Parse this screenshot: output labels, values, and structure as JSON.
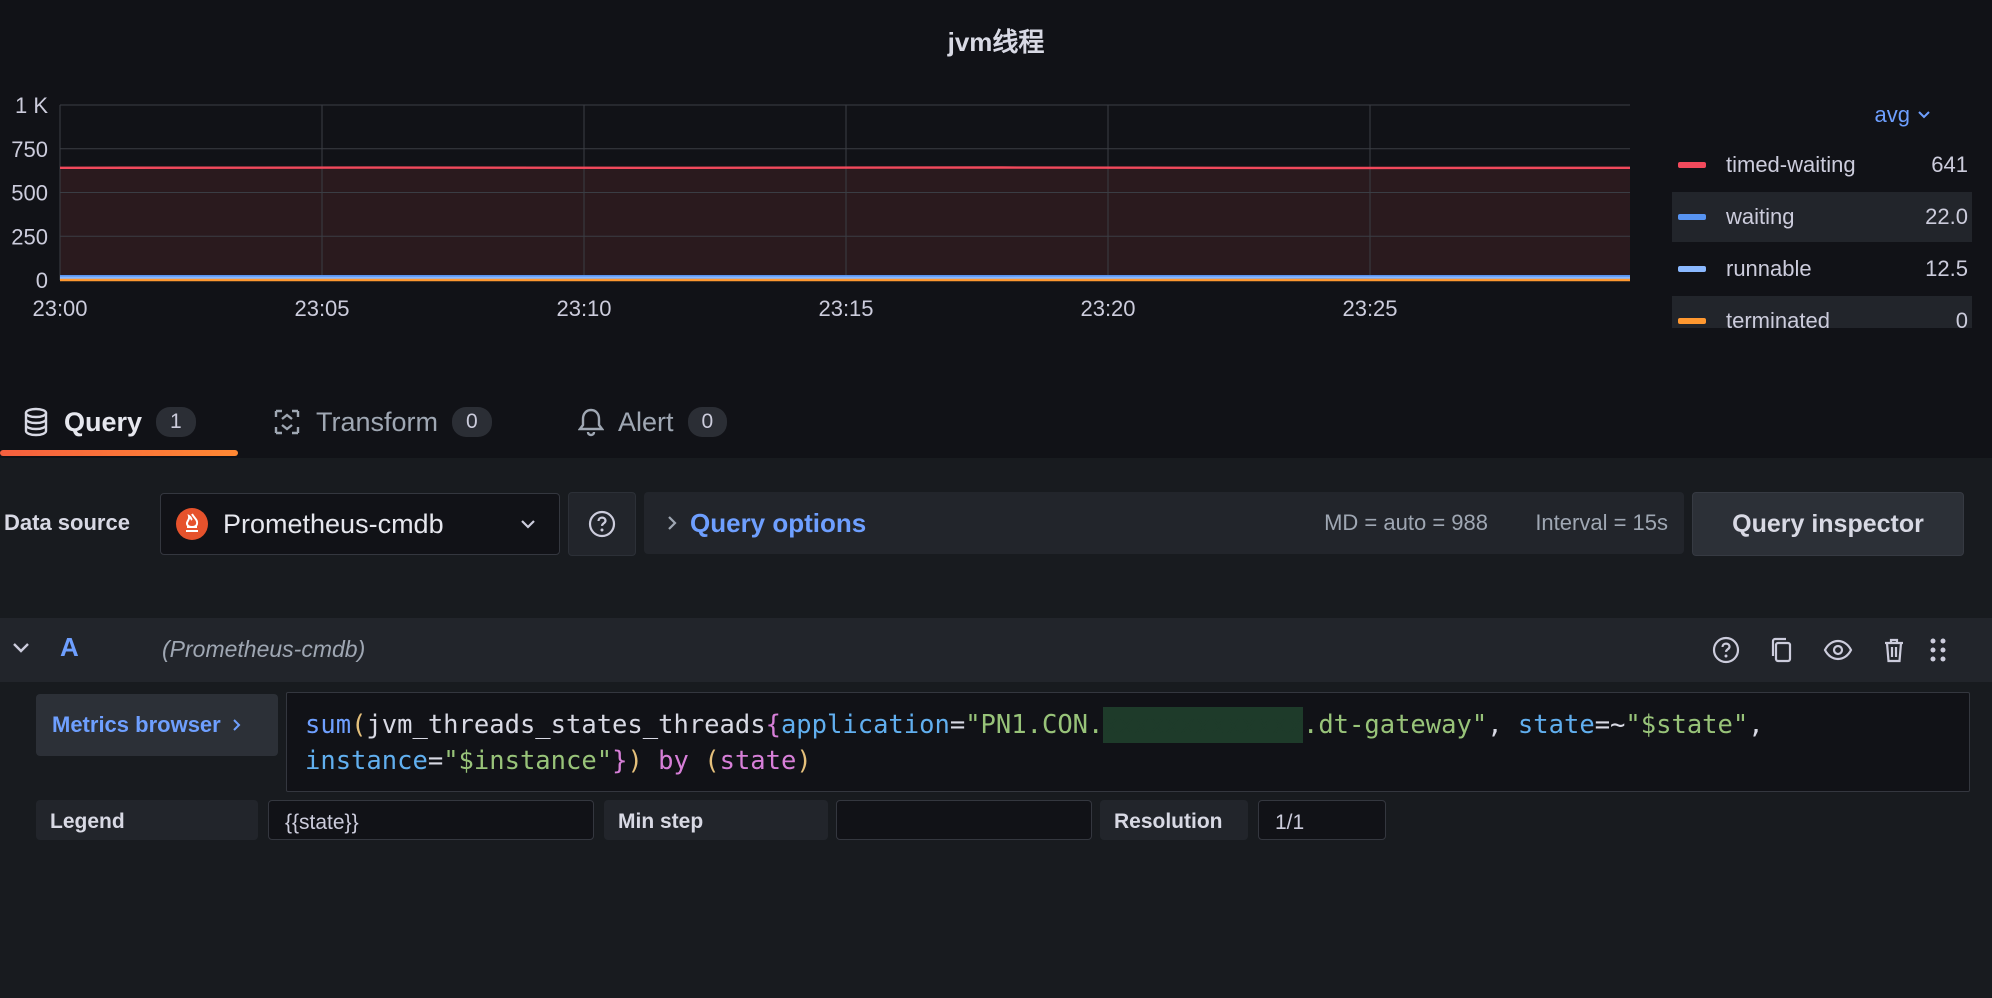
{
  "panel": {
    "title": "jvm线程"
  },
  "chart_data": {
    "type": "line",
    "x": [
      "23:00",
      "23:05",
      "23:10",
      "23:15",
      "23:20",
      "23:25"
    ],
    "ytick_labels": [
      "0",
      "250",
      "500",
      "750",
      "1 K"
    ],
    "ylim": [
      0,
      1000
    ],
    "grid": true,
    "series": [
      {
        "name": "timed-waiting",
        "color": "#f2495c",
        "values": [
          641,
          642,
          641,
          643,
          640,
          641
        ]
      },
      {
        "name": "waiting",
        "color": "#5794f2",
        "values": [
          22,
          22,
          22,
          22,
          22,
          22
        ]
      },
      {
        "name": "runnable",
        "color": "#8ab8ff",
        "values": [
          12.5,
          12,
          13,
          12,
          14,
          12
        ]
      },
      {
        "name": "terminated",
        "color": "#ff9830",
        "values": [
          0,
          0,
          0,
          0,
          0,
          0
        ]
      }
    ]
  },
  "legend": {
    "calc": "avg",
    "items": [
      {
        "name": "timed-waiting",
        "value": "641",
        "color": "#f2495c"
      },
      {
        "name": "waiting",
        "value": "22.0",
        "color": "#5794f2"
      },
      {
        "name": "runnable",
        "value": "12.5",
        "color": "#8ab8ff"
      },
      {
        "name": "terminated",
        "value": "0",
        "color": "#ff9830"
      }
    ]
  },
  "tabs": [
    {
      "label": "Query",
      "count": "1",
      "icon": "database-icon"
    },
    {
      "label": "Transform",
      "count": "0",
      "icon": "transform-icon"
    },
    {
      "label": "Alert",
      "count": "0",
      "icon": "bell-icon"
    }
  ],
  "toolbar": {
    "datasource_label": "Data source",
    "datasource_name": "Prometheus-cmdb",
    "query_options_label": "Query options",
    "md": "MD = auto = 988",
    "interval": "Interval = 15s",
    "query_inspector_label": "Query inspector"
  },
  "query": {
    "ref_id": "A",
    "datasource": "(Prometheus-cmdb)",
    "metrics_browser_label": "Metrics browser",
    "expr_fn": "sum",
    "expr_metric": "jvm_threads_states_threads",
    "expr_app_label": "application",
    "expr_app_prefix": "\"PN1.CON.",
    "expr_app_suffix": ".dt-gateway\"",
    "expr_state_label": "state",
    "expr_state_value": "\"$state\"",
    "expr_instance_label": "instance",
    "expr_instance_value": "\"$instance\"",
    "expr_by": "by",
    "expr_group": "state"
  },
  "options": {
    "legend_label": "Legend",
    "legend_value": "{{state}}",
    "min_step_label": "Min step",
    "resolution_label": "Resolution",
    "resolution_value": "1/1"
  }
}
